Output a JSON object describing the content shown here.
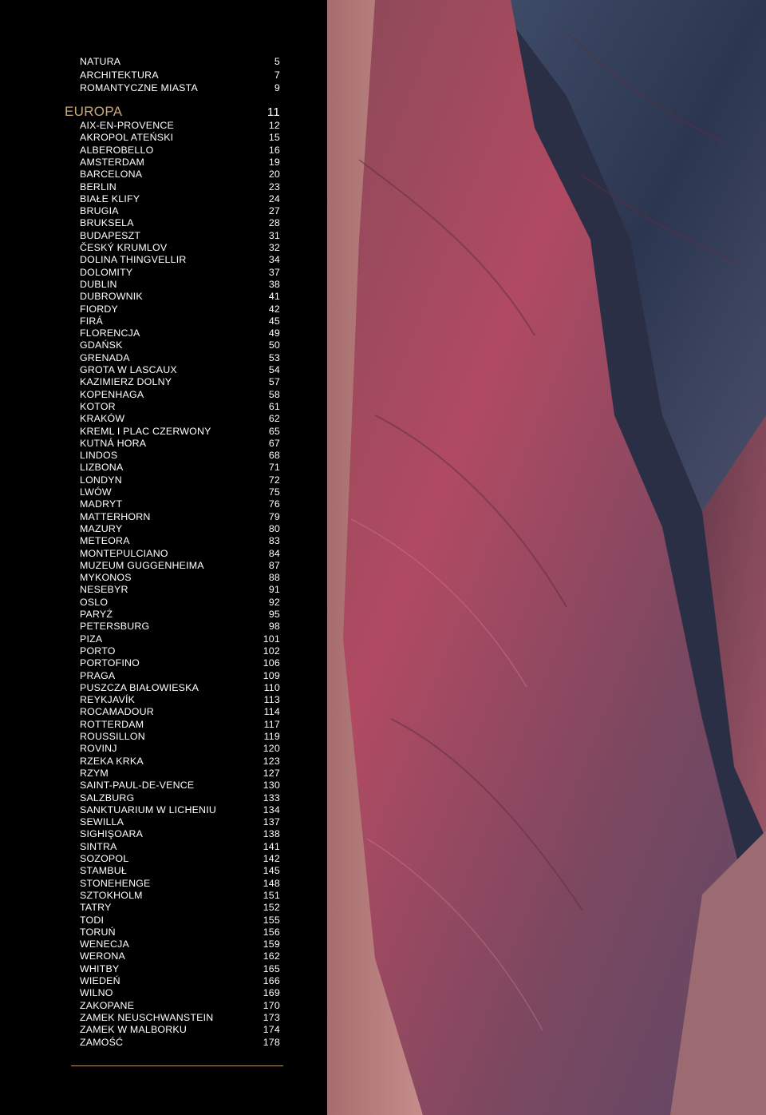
{
  "intro": [
    {
      "title": "NATURA",
      "page": "5"
    },
    {
      "title": "ARCHITEKTURA",
      "page": "7"
    },
    {
      "title": "ROMANTYCZNE MIASTA",
      "page": "9"
    }
  ],
  "section": {
    "title": "EUROPA",
    "page": "11"
  },
  "entries": [
    {
      "title": "AIX-EN-PROVENCE",
      "page": "12"
    },
    {
      "title": "AKROPOL ATEŃSKI",
      "page": "15"
    },
    {
      "title": "ALBEROBELLO",
      "page": "16"
    },
    {
      "title": "AMSTERDAM",
      "page": "19"
    },
    {
      "title": "BARCELONA",
      "page": "20"
    },
    {
      "title": "BERLIN",
      "page": "23"
    },
    {
      "title": "BIAŁE KLIFY",
      "page": "24"
    },
    {
      "title": "BRUGIA",
      "page": "27"
    },
    {
      "title": "BRUKSELA",
      "page": "28"
    },
    {
      "title": "BUDAPESZT",
      "page": "31"
    },
    {
      "title": "ČESKÝ KRUMLOV",
      "page": "32"
    },
    {
      "title": "DOLINA THINGVELLIR",
      "page": "34"
    },
    {
      "title": "DOLOMITY",
      "page": "37"
    },
    {
      "title": "DUBLIN",
      "page": "38"
    },
    {
      "title": "DUBROWNIK",
      "page": "41"
    },
    {
      "title": "FIORDY",
      "page": "42"
    },
    {
      "title": "FIRÁ",
      "page": "45"
    },
    {
      "title": "FLORENCJA",
      "page": "49"
    },
    {
      "title": "GDAŃSK",
      "page": "50"
    },
    {
      "title": "GRENADA",
      "page": "53"
    },
    {
      "title": "GROTA W LASCAUX",
      "page": "54"
    },
    {
      "title": "KAZIMIERZ DOLNY",
      "page": "57"
    },
    {
      "title": "KOPENHAGA",
      "page": "58"
    },
    {
      "title": "KOTOR",
      "page": "61"
    },
    {
      "title": "KRAKÓW",
      "page": "62"
    },
    {
      "title": "KREML I PLAC CZERWONY",
      "page": "65"
    },
    {
      "title": "KUTNÁ HORA",
      "page": "67"
    },
    {
      "title": "LINDOS",
      "page": "68"
    },
    {
      "title": "LIZBONA",
      "page": "71"
    },
    {
      "title": "LONDYN",
      "page": "72"
    },
    {
      "title": "LWÓW",
      "page": "75"
    },
    {
      "title": "MADRYT",
      "page": "76"
    },
    {
      "title": "MATTERHORN",
      "page": "79"
    },
    {
      "title": "MAZURY",
      "page": "80"
    },
    {
      "title": "METEORA",
      "page": "83"
    },
    {
      "title": "MONTEPULCIANO",
      "page": "84"
    },
    {
      "title": "MUZEUM GUGGENHEIMA",
      "page": "87"
    },
    {
      "title": "MYKONOS",
      "page": "88"
    },
    {
      "title": "NESEBYR",
      "page": "91"
    },
    {
      "title": "OSLO",
      "page": "92"
    },
    {
      "title": "PARYŻ",
      "page": "95"
    },
    {
      "title": "PETERSBURG",
      "page": "98"
    },
    {
      "title": "PIZA",
      "page": "101"
    },
    {
      "title": "PORTO",
      "page": "102"
    },
    {
      "title": "PORTOFINO",
      "page": "106"
    },
    {
      "title": "PRAGA",
      "page": "109"
    },
    {
      "title": "PUSZCZA BIAŁOWIESKA",
      "page": "110"
    },
    {
      "title": "REYKJAVÍK",
      "page": "113"
    },
    {
      "title": "ROCAMADOUR",
      "page": "114"
    },
    {
      "title": "ROTTERDAM",
      "page": "117"
    },
    {
      "title": "ROUSSILLON",
      "page": "119"
    },
    {
      "title": "ROVINJ",
      "page": "120"
    },
    {
      "title": "RZEKA KRKA",
      "page": "123"
    },
    {
      "title": "RZYM",
      "page": "127"
    },
    {
      "title": "SAINT-PAUL-DE-VENCE",
      "page": "130"
    },
    {
      "title": "SALZBURG",
      "page": "133"
    },
    {
      "title": "SANKTUARIUM W LICHENIU",
      "page": "134"
    },
    {
      "title": "SEWILLA",
      "page": "137"
    },
    {
      "title": "SIGHIŞOARA",
      "page": "138"
    },
    {
      "title": "SINTRA",
      "page": "141"
    },
    {
      "title": "SOZOPOL",
      "page": "142"
    },
    {
      "title": "STAMBUŁ",
      "page": "145"
    },
    {
      "title": "STONEHENGE",
      "page": "148"
    },
    {
      "title": "SZTOKHOLM",
      "page": "151"
    },
    {
      "title": "TATRY",
      "page": "152"
    },
    {
      "title": "TODI",
      "page": "155"
    },
    {
      "title": "TORUŃ",
      "page": "156"
    },
    {
      "title": "WENECJA",
      "page": "159"
    },
    {
      "title": "WERONA",
      "page": "162"
    },
    {
      "title": "WHITBY",
      "page": "165"
    },
    {
      "title": "WIEDEŃ",
      "page": "166"
    },
    {
      "title": "WILNO",
      "page": "169"
    },
    {
      "title": "ZAKOPANE",
      "page": "170"
    },
    {
      "title": "ZAMEK NEUSCHWANSTEIN",
      "page": "173"
    },
    {
      "title": "ZAMEK W MALBORKU",
      "page": "174"
    },
    {
      "title": "ZAMOŚĆ",
      "page": "178"
    }
  ],
  "colors": {
    "section_heading": "#c9a978",
    "rule": "#b9996a",
    "background": "#000000",
    "text": "#ffffff"
  },
  "photo": {
    "icon": "canyon-rock-photo"
  }
}
